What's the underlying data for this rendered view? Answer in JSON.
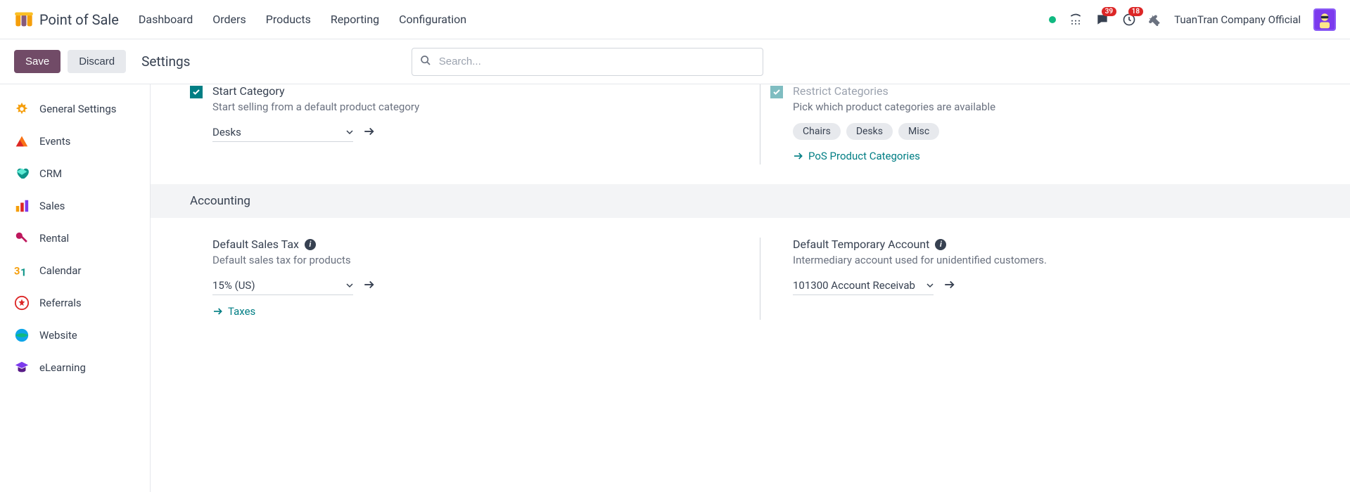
{
  "header": {
    "app_name": "Point of Sale",
    "nav": [
      "Dashboard",
      "Orders",
      "Products",
      "Reporting",
      "Configuration"
    ],
    "messages_badge": "39",
    "activities_badge": "18",
    "company": "TuanTran Company Official"
  },
  "controlbar": {
    "save": "Save",
    "discard": "Discard",
    "breadcrumb": "Settings",
    "search_placeholder": "Search..."
  },
  "sidebar": {
    "items": [
      {
        "label": "General Settings"
      },
      {
        "label": "Events"
      },
      {
        "label": "CRM"
      },
      {
        "label": "Sales"
      },
      {
        "label": "Rental"
      },
      {
        "label": "Calendar"
      },
      {
        "label": "Referrals"
      },
      {
        "label": "Website"
      },
      {
        "label": "eLearning"
      }
    ]
  },
  "settings": {
    "start_category": {
      "title": "Start Category",
      "desc": "Start selling from a default product category",
      "value": "Desks"
    },
    "restrict_categories": {
      "title": "Restrict Categories",
      "desc": "Pick which product categories are available",
      "tags": [
        "Chairs",
        "Desks",
        "Misc"
      ],
      "link": "PoS Product Categories"
    },
    "accounting_header": "Accounting",
    "default_sales_tax": {
      "title": "Default Sales Tax",
      "desc": "Default sales tax for products",
      "value": "15% (US)",
      "link": "Taxes"
    },
    "default_temp_account": {
      "title": "Default Temporary Account",
      "desc": "Intermediary account used for unidentified customers.",
      "value": "101300 Account Receivab"
    }
  }
}
